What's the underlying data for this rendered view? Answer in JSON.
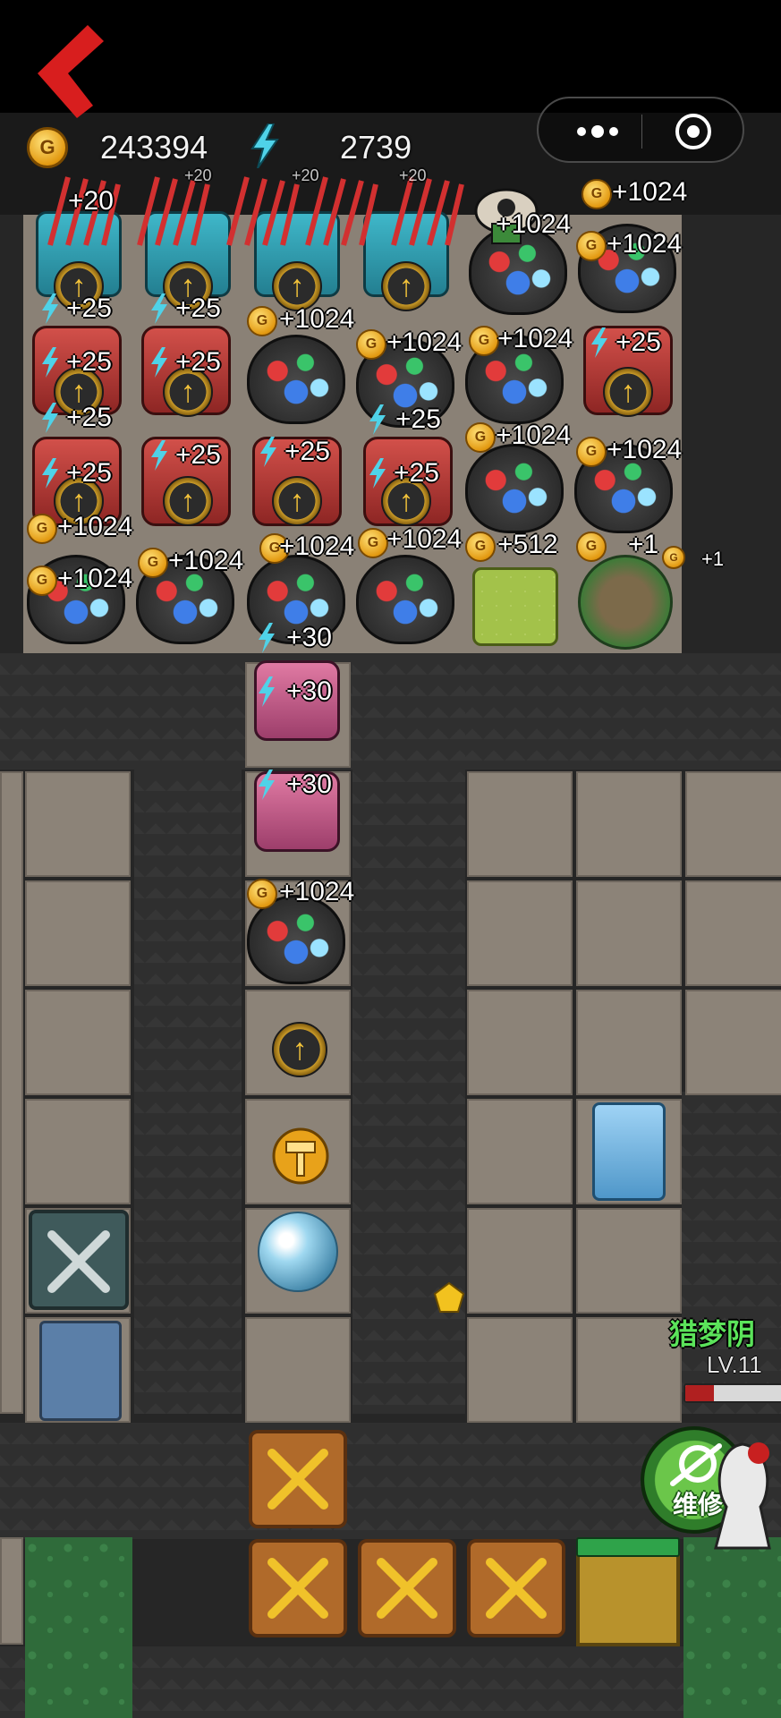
{
  "hud": {
    "coins": "243394",
    "energy": "2739",
    "coin_symbol": "G"
  },
  "floating": {
    "plus20": "+20",
    "plus25": "+25",
    "plus30": "+30",
    "plus1024": "+1024",
    "plus512": "+512",
    "plus1": "+1"
  },
  "upgrade_glyph": "↑",
  "enemy": {
    "name": "猎梦阴",
    "level": "LV.11",
    "hp_fraction": 0.28
  },
  "repair_button": {
    "label": "维修"
  },
  "colors": {
    "back_chevron": "#d81e1e",
    "enemy_name": "#5be35a",
    "repair": "#6bc64a"
  }
}
